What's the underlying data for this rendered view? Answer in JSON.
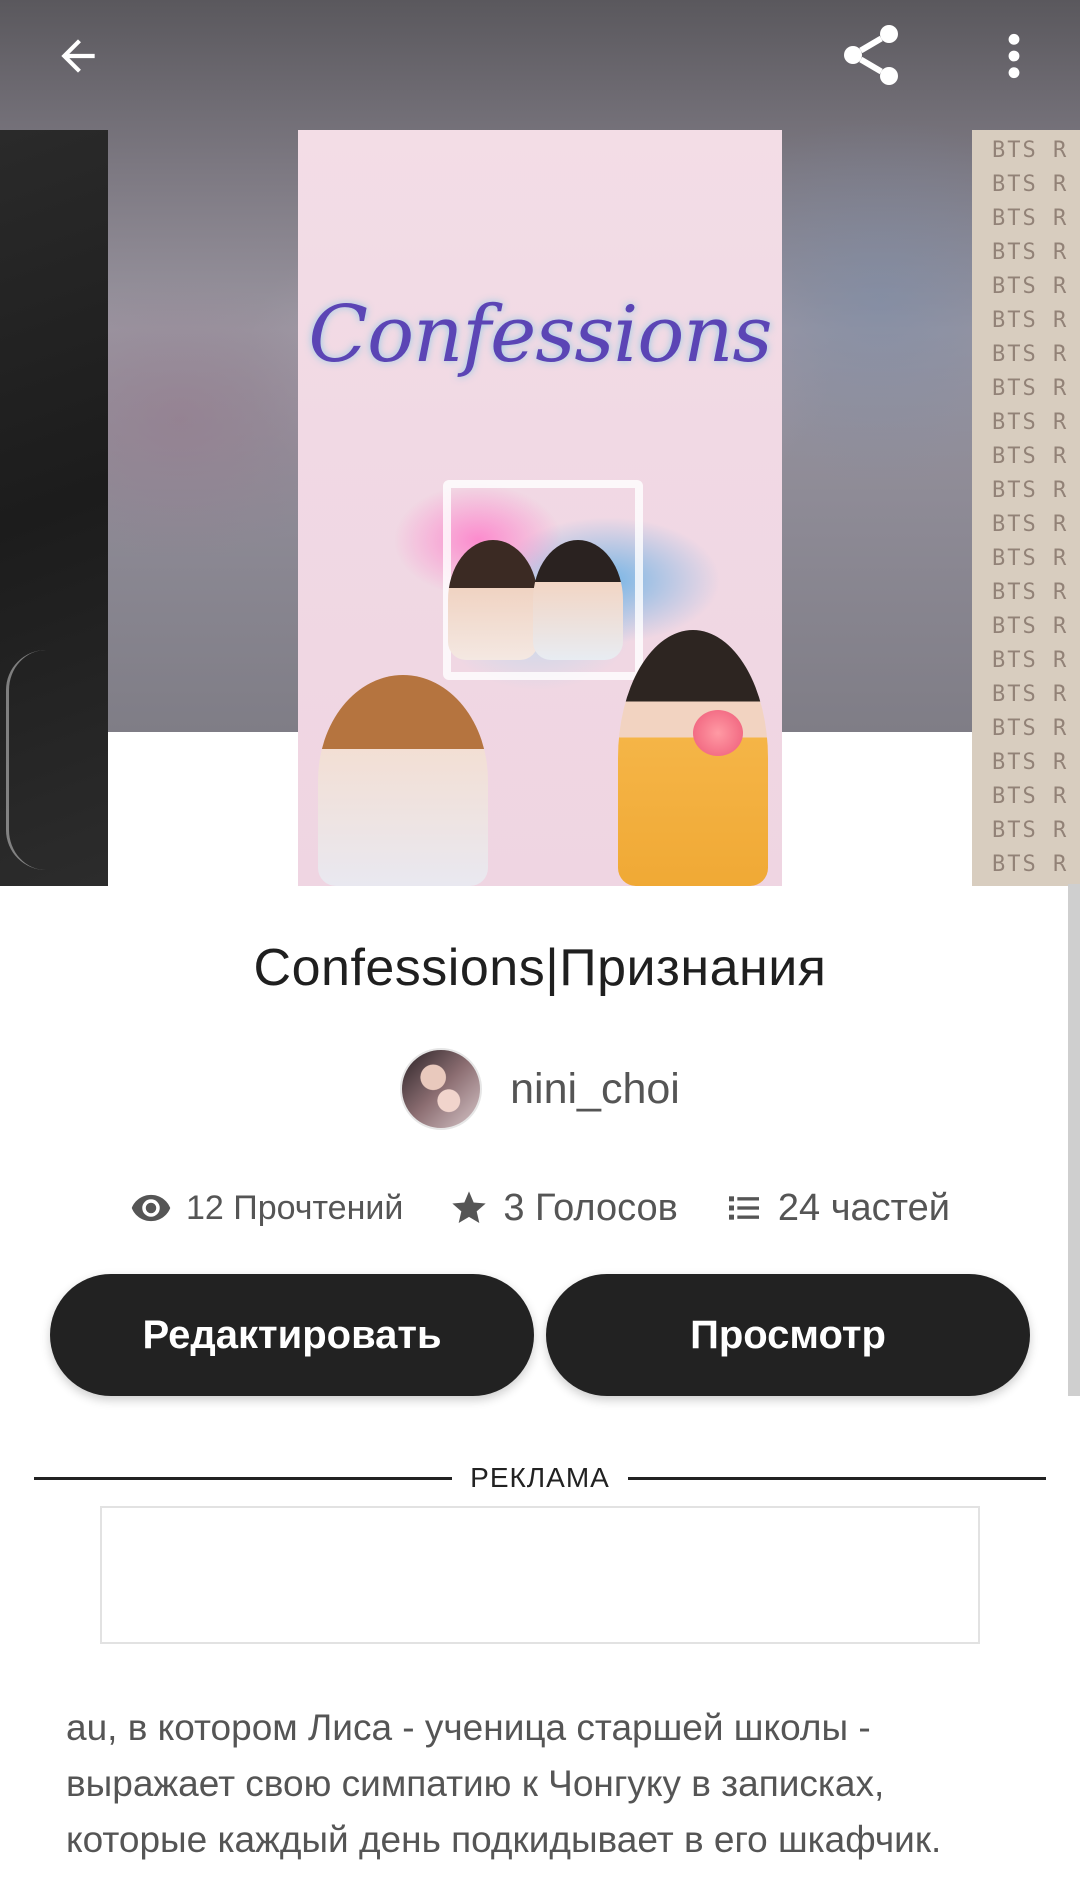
{
  "header": {
    "back_icon": "arrow-left-icon",
    "share_icon": "share-icon",
    "more_icon": "more-vertical-icon"
  },
  "carousel": {
    "main_cover_title": "Confessions",
    "right_cover_text": "BTS R"
  },
  "book": {
    "title": "Confessions|Признания",
    "author": "nini_choi"
  },
  "stats": {
    "reads": "12 Прочтений",
    "votes": "3 Голосов",
    "parts": "24 частей"
  },
  "actions": {
    "edit_label": "Редактировать",
    "view_label": "Просмотр"
  },
  "ad": {
    "label": "РЕКЛАМА"
  },
  "description": {
    "text": "au, в котором Лиса - ученица старшей школы - выражает свою симпатию к Чонгуку в записках, которые каждый день подкидывает в его шкафчик."
  },
  "colors": {
    "button_bg": "#222222",
    "button_text": "#ffffff",
    "cover_title": "#5b45b5"
  }
}
